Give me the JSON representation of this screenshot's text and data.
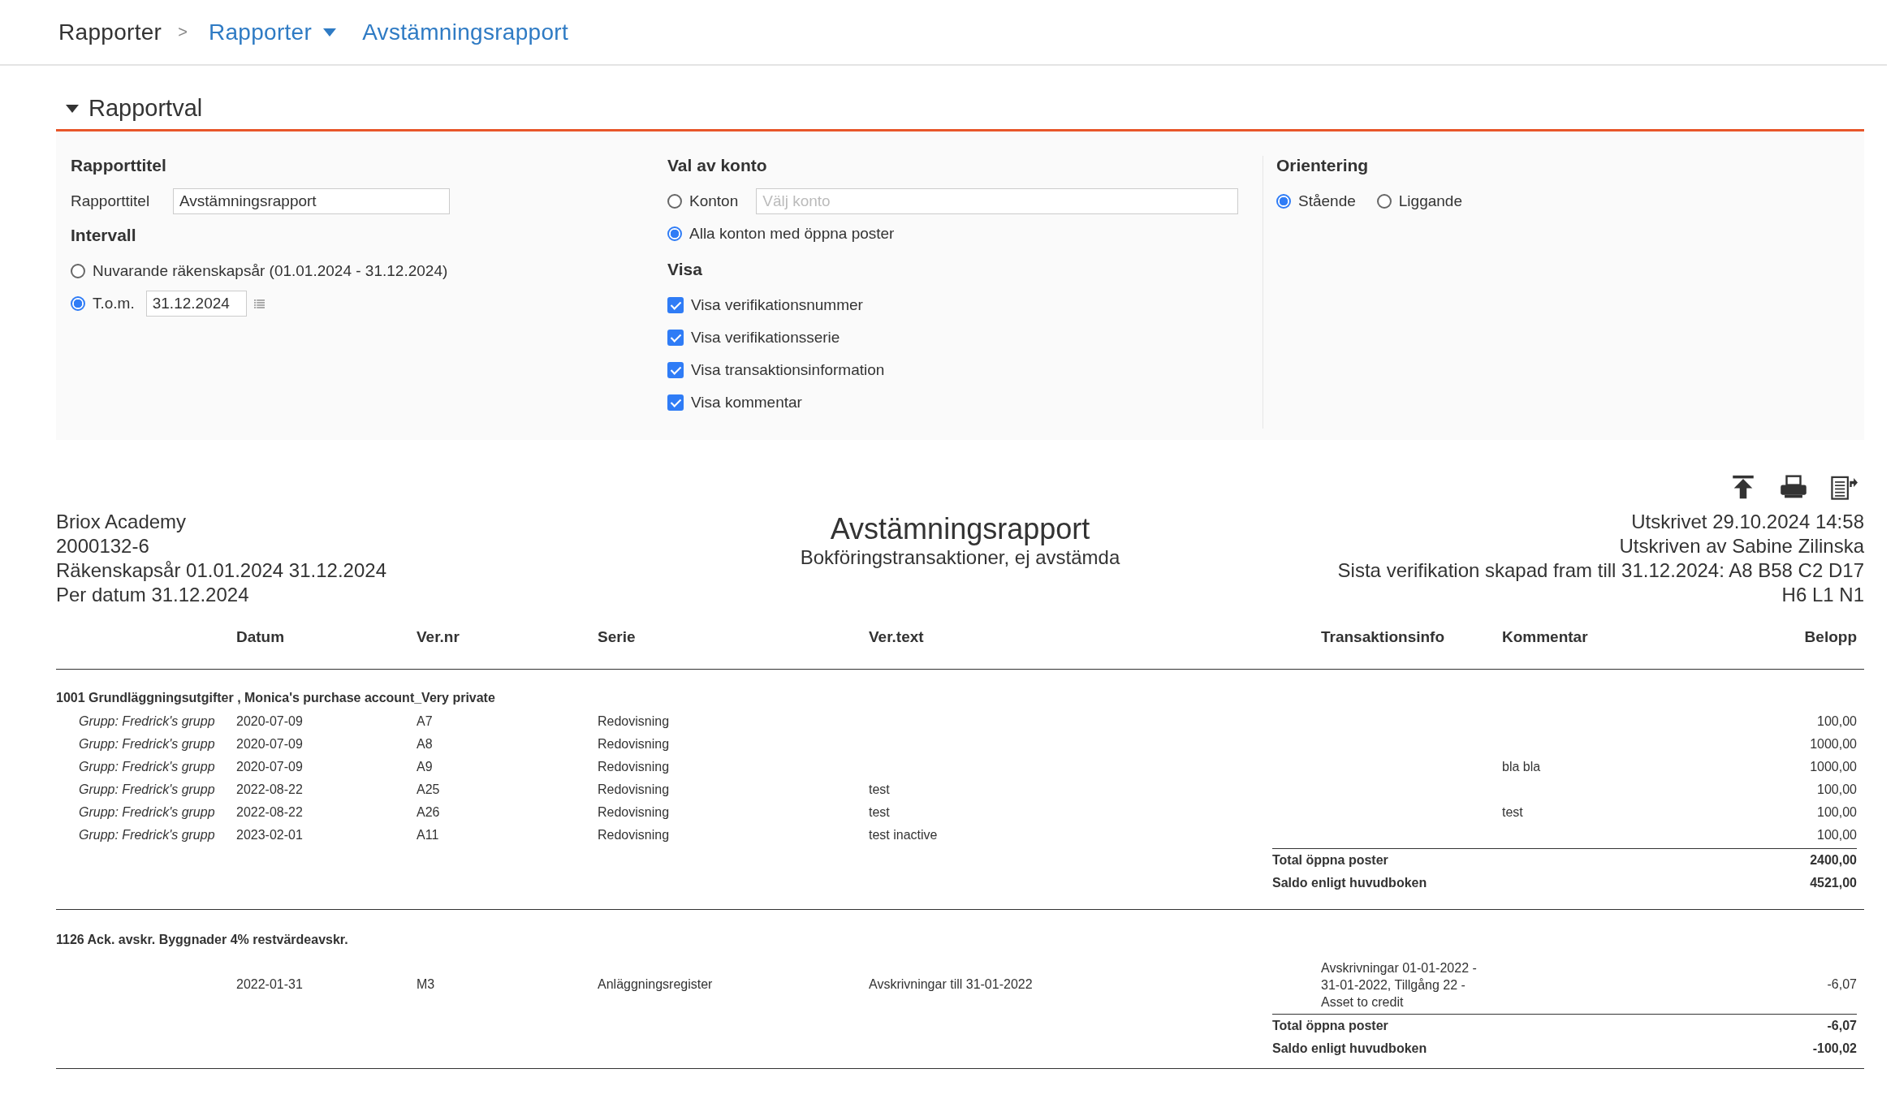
{
  "breadcrumb": [
    {
      "label": "Rapporter",
      "link": false,
      "dropdown": false,
      "separator": ">"
    },
    {
      "label": "Rapporter",
      "link": true,
      "dropdown": true
    },
    {
      "label": "Avstämningsrapport",
      "link": true,
      "dropdown": false
    }
  ],
  "section": {
    "title": "Rapportval",
    "expanded": true
  },
  "rapporttitel": {
    "heading": "Rapporttitel",
    "label": "Rapporttitel",
    "value": "Avstämningsrapport"
  },
  "intervall": {
    "heading": "Intervall",
    "options": [
      {
        "kind": "plain",
        "label": "Nuvarande räkenskapsår (01.01.2024 - 31.12.2024)",
        "selected": false
      },
      {
        "kind": "date",
        "label": "T.o.m.",
        "selected": true,
        "value": "31.12.2024"
      }
    ]
  },
  "konto": {
    "heading": "Val av konto",
    "options": [
      {
        "kind": "field",
        "label": "Konton",
        "selected": false,
        "placeholder": "Välj konto"
      },
      {
        "kind": "plain",
        "label": "Alla konton med öppna poster",
        "selected": true
      }
    ]
  },
  "visa": {
    "heading": "Visa",
    "checks": [
      {
        "label": "Visa verifikationsnummer",
        "checked": true
      },
      {
        "label": "Visa verifikationsserie",
        "checked": true
      },
      {
        "label": "Visa transaktionsinformation",
        "checked": true
      },
      {
        "label": "Visa kommentar",
        "checked": true
      }
    ]
  },
  "orientering": {
    "heading": "Orientering",
    "options": [
      {
        "label": "Stående",
        "selected": true
      },
      {
        "label": "Liggande",
        "selected": false
      }
    ]
  },
  "report": {
    "left": [
      "Briox Academy",
      "2000132-6",
      "Räkenskapsår 01.01.2024 31.12.2024",
      "Per datum 31.12.2024"
    ],
    "title": "Avstämningsrapport",
    "subtitle": "Bokföringstransaktioner, ej avstämda",
    "right": [
      "Utskrivet 29.10.2024 14:58",
      "Utskriven av Sabine Zilinska",
      "Sista verifikation skapad fram till 31.12.2024: A8 B58 C2 D17",
      "H6 L1 N1"
    ],
    "columns": [
      "Datum",
      "Ver.nr",
      "Serie",
      "Ver.text",
      "Transaktionsinfo",
      "Kommentar",
      "Belopp"
    ],
    "accounts": [
      {
        "header": "1001 Grundläggningsutgifter , Monica's purchase account_Very private",
        "rows": [
          {
            "group": "Grupp: Fredrick's grupp",
            "datum": "2020-07-09",
            "vernr": "A7",
            "serie": "Redovisning",
            "belopp": "100,00"
          },
          {
            "group": "Grupp: Fredrick's grupp",
            "datum": "2020-07-09",
            "vernr": "A8",
            "serie": "Redovisning",
            "belopp": "1000,00"
          },
          {
            "group": "Grupp: Fredrick's grupp",
            "datum": "2020-07-09",
            "vernr": "A9",
            "serie": "Redovisning",
            "kommentar": "bla bla",
            "belopp": "1000,00"
          },
          {
            "group": "Grupp: Fredrick's grupp",
            "datum": "2022-08-22",
            "vernr": "A25",
            "serie": "Redovisning",
            "vertext": "test",
            "belopp": "100,00"
          },
          {
            "group": "Grupp: Fredrick's grupp",
            "datum": "2022-08-22",
            "vernr": "A26",
            "serie": "Redovisning",
            "vertext": "test",
            "kommentar": "test",
            "belopp": "100,00"
          },
          {
            "group": "Grupp: Fredrick's grupp",
            "datum": "2023-02-01",
            "vernr": "A11",
            "serie": "Redovisning",
            "vertext": "test inactive",
            "belopp": "100,00"
          }
        ],
        "totals": [
          {
            "label": "Total öppna poster",
            "value": "2400,00"
          },
          {
            "label": "Saldo enligt huvudboken",
            "value": "4521,00"
          }
        ]
      },
      {
        "header": "1126 Ack. avskr. Byggnader 4% restvärdeavskr.",
        "rows": [
          {
            "datum": "2022-01-31",
            "vernr": "M3",
            "serie": "Anläggningsregister",
            "vertext": "Avskrivningar till 31-01-2022",
            "transinfo": "Avskrivningar 01-01-2022 - 31-01-2022, Tillgång 22 - Asset to credit",
            "belopp": "-6,07"
          }
        ],
        "totals": [
          {
            "label": "Total öppna poster",
            "value": "-6,07"
          },
          {
            "label": "Saldo enligt huvudboken",
            "value": "-100,02"
          }
        ]
      }
    ]
  }
}
